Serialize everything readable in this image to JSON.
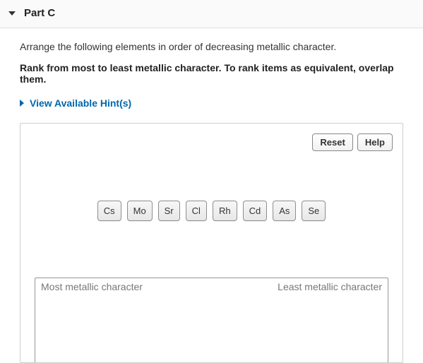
{
  "part": {
    "title": "Part C"
  },
  "instructions": {
    "line1": "Arrange the following elements in order of decreasing metallic character.",
    "line2": "Rank from most to least metallic character. To rank items as equivalent, overlap them."
  },
  "hints": {
    "label": "View Available Hint(s)"
  },
  "buttons": {
    "reset": "Reset",
    "help": "Help"
  },
  "elements": {
    "items": [
      "Cs",
      "Mo",
      "Sr",
      "Cl",
      "Rh",
      "Cd",
      "As",
      "Se"
    ]
  },
  "dropzone": {
    "left_label": "Most metallic character",
    "right_label": "Least metallic character"
  }
}
